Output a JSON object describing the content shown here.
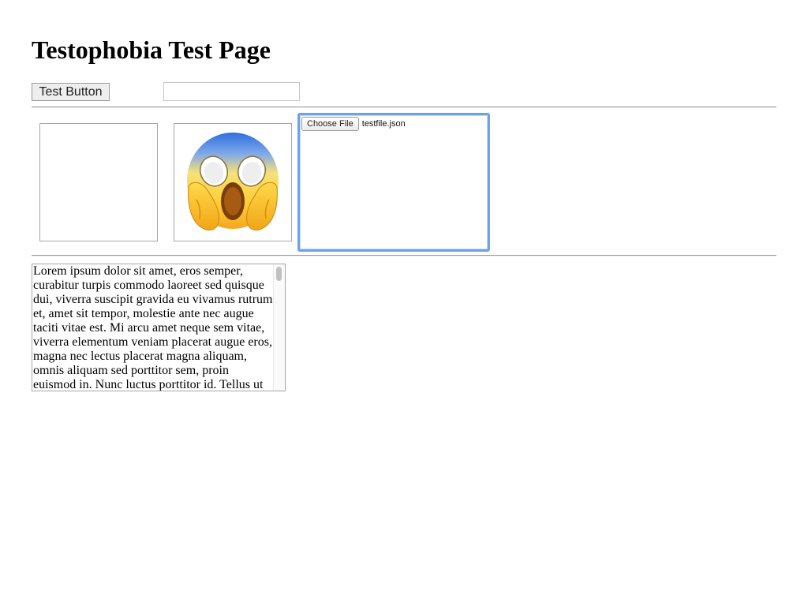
{
  "page": {
    "title": "Testophobia Test Page"
  },
  "controls": {
    "test_button_label": "Test Button",
    "text_input_value": "",
    "text_input_placeholder": ""
  },
  "file_upload": {
    "button_label": "Choose File",
    "file_name": "testfile.json"
  },
  "emoji": {
    "icon": "face-screaming-in-fear-icon",
    "glyph": "😱"
  },
  "textarea": {
    "text": "Lorem ipsum dolor sit amet, eros semper, curabitur turpis commodo laoreet sed quisque dui, viverra suscipit gravida eu vivamus rutrum et, amet sit tempor, molestie ante nec augue taciti vitae est. Mi arcu amet neque sem vitae, viverra elementum veniam placerat augue eros, magna nec lectus placerat magna aliquam, omnis aliquam sed porttitor sem, proin euismod in. Nunc luctus porttitor id. Tellus ut"
  },
  "colors": {
    "focus_ring": "#6aa2f0",
    "border": "#a6a6a6",
    "button_background": "#eeeeee"
  }
}
